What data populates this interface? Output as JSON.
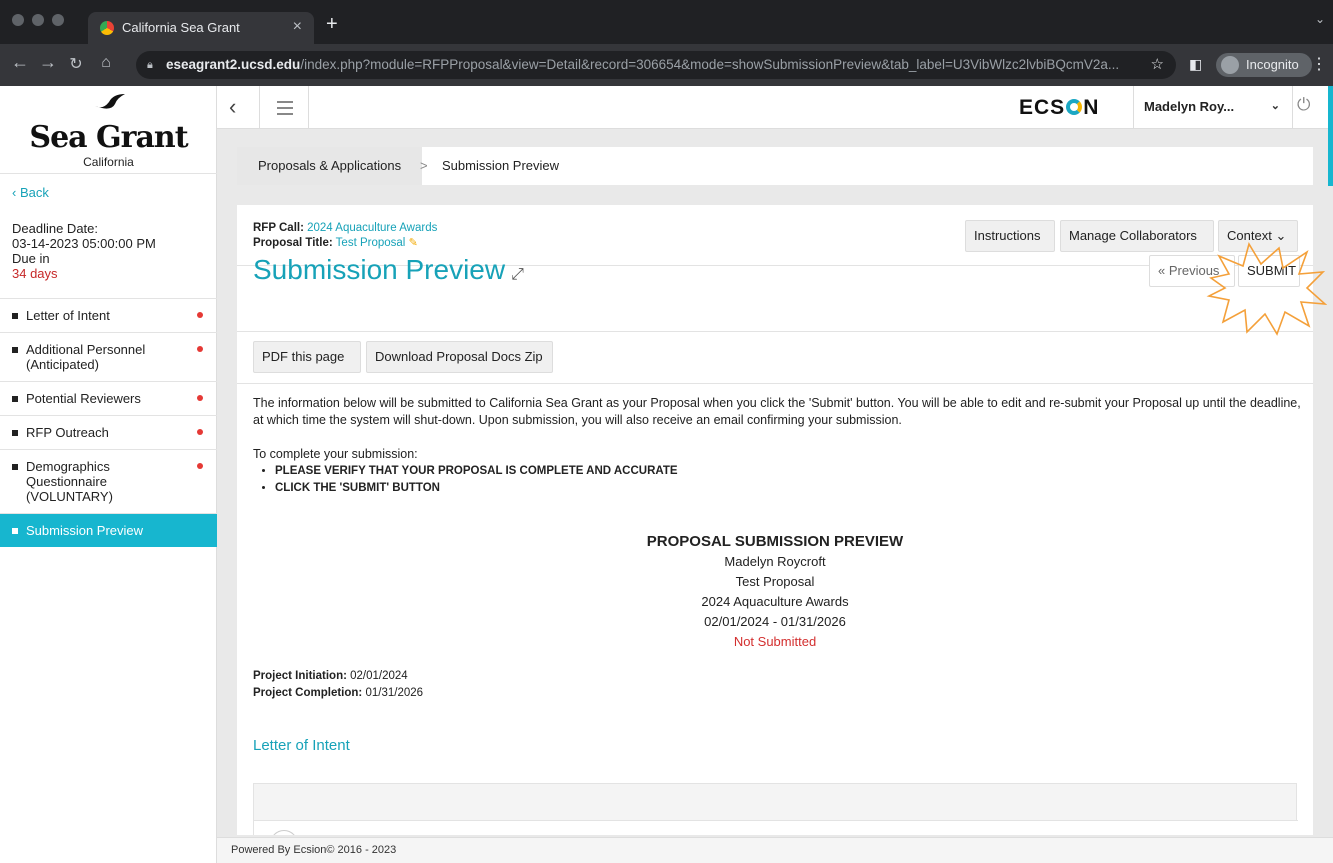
{
  "browser": {
    "tab_title": "California Sea Grant",
    "url_host": "eseagrant2.ucsd.edu",
    "url_path": "/index.php?module=RFPProposal&view=Detail&record=306654&mode=showSubmissionPreview&tab_label=U3VibWlzc2lvbiBQcmV2a...",
    "incognito_label": "Incognito"
  },
  "sidebar": {
    "brand": "Sea Grant",
    "brand_sub": "California",
    "back_label": "Back",
    "deadline_label": "Deadline Date:",
    "deadline_value": "03-14-2023 05:00:00 PM",
    "due_in_label": "Due in",
    "due_in_value": "34 days",
    "items": [
      {
        "label": "Letter of Intent",
        "incomplete": true
      },
      {
        "label": "Additional Personnel (Anticipated)",
        "incomplete": true
      },
      {
        "label": "Potential Reviewers",
        "incomplete": true
      },
      {
        "label": "RFP Outreach",
        "incomplete": true
      },
      {
        "label": "Demographics Questionnaire (VOLUNTARY)",
        "incomplete": true
      },
      {
        "label": "Submission Preview",
        "incomplete": false,
        "active": true
      }
    ]
  },
  "header": {
    "logo_text_before": "ECS",
    "logo_text_after": "N",
    "user_name": "Madelyn Roy..."
  },
  "breadcrumb": {
    "root": "Proposals & Applications",
    "separator": ">",
    "current": "Submission Preview"
  },
  "card": {
    "rfp_call_label": "RFP Call:",
    "rfp_call_value": "2024 Aquaculture Awards",
    "proposal_title_label": "Proposal Title:",
    "proposal_title_value": "Test Proposal",
    "instructions_label": "Instructions",
    "manage_collaborators_label": "Manage Collaborators",
    "context_label": "Context",
    "page_title": "Submission Preview",
    "previous_label": "« Previous",
    "submit_label": "SUBMIT",
    "pdf_label": "PDF this page",
    "download_label": "Download Proposal Docs Zip",
    "notice_text": "The information below will be submitted to California Sea Grant as your Proposal when you click the 'Submit' button. You will be able to edit and re-submit your Proposal up until the deadline, at which time the system will shut-down. Upon submission, you will also receive an email confirming your submission.",
    "complete_intro": "To complete your submission:",
    "steps": [
      "PLEASE VERIFY THAT YOUR PROPOSAL IS COMPLETE AND ACCURATE",
      "CLICK THE 'SUBMIT' BUTTON"
    ],
    "preview_heading": "PROPOSAL SUBMISSION PREVIEW",
    "preview_name": "Madelyn Roycroft",
    "preview_title": "Test Proposal",
    "preview_rfp": "2024 Aquaculture Awards",
    "preview_dates": "02/01/2024 - 01/31/2026",
    "preview_status": "Not Submitted",
    "project_initiation_label": "Project Initiation:",
    "project_initiation_value": "02/01/2024",
    "project_completion_label": "Project Completion:",
    "project_completion_value": "01/31/2026",
    "section_loi": "Letter of Intent"
  },
  "footer": {
    "text": "Powered By Ecsion© 2016 - 2023"
  },
  "colors": {
    "accent": "#17a2b8",
    "active_nav": "#17b6cf",
    "alert": "#e53935",
    "highlight": "#f4a03a"
  }
}
